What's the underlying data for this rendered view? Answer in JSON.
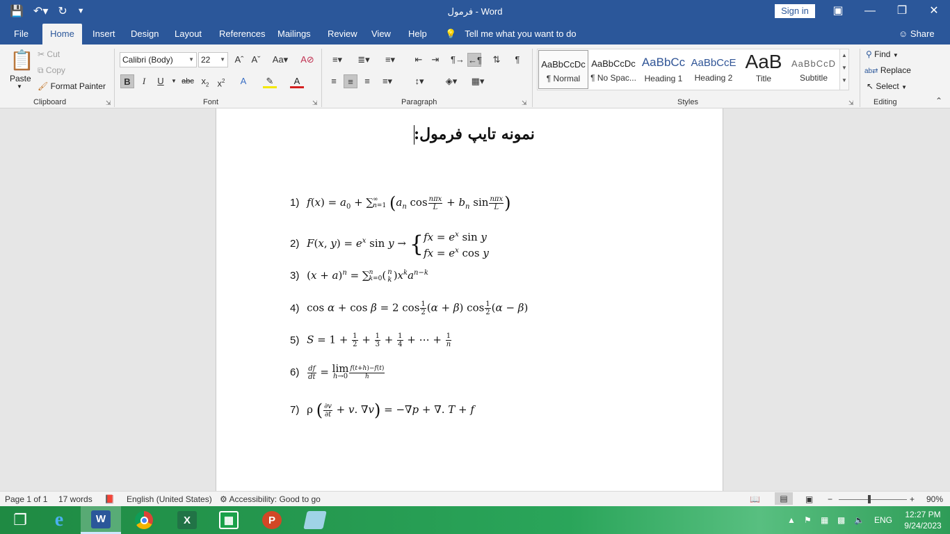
{
  "window": {
    "title": "فرمول  -  Word",
    "sign_in": "Sign in"
  },
  "tabs": [
    {
      "label": "File"
    },
    {
      "label": "Home"
    },
    {
      "label": "Insert"
    },
    {
      "label": "Design"
    },
    {
      "label": "Layout"
    },
    {
      "label": "References"
    },
    {
      "label": "Mailings"
    },
    {
      "label": "Review"
    },
    {
      "label": "View"
    },
    {
      "label": "Help"
    }
  ],
  "tell_me": "Tell me what you want to do",
  "share": "Share",
  "clipboard": {
    "paste": "Paste",
    "cut": "Cut",
    "copy": "Copy",
    "format_painter": "Format Painter",
    "label": "Clipboard"
  },
  "font": {
    "name": "Calibri (Body)",
    "size": "22",
    "label": "Font"
  },
  "paragraph": {
    "label": "Paragraph"
  },
  "styles": {
    "label": "Styles",
    "items": [
      {
        "sample": "AaBbCcDc",
        "name": "¶ Normal"
      },
      {
        "sample": "AaBbCcDc",
        "name": "¶ No Spac..."
      },
      {
        "sample": "AaBbCc",
        "name": "Heading 1"
      },
      {
        "sample": "AaBbCcE",
        "name": "Heading 2"
      },
      {
        "sample": "AaB",
        "name": "Title"
      },
      {
        "sample": "AaBbCcD",
        "name": "Subtitle"
      }
    ]
  },
  "editing": {
    "find": "Find",
    "replace": "Replace",
    "select": "Select",
    "label": "Editing"
  },
  "document": {
    "heading": "نمونه تایپ فرمول:",
    "formula_numbers": [
      "1)",
      "2)",
      "3)",
      "4)",
      "5)",
      "6)",
      "7)"
    ]
  },
  "status": {
    "page": "Page 1 of 1",
    "words": "17 words",
    "language": "English (United States)",
    "accessibility": "Accessibility: Good to go",
    "zoom": "90%"
  },
  "taskbar": {
    "lang": "ENG",
    "time": "12:27 PM",
    "date": "9/24/2023"
  }
}
